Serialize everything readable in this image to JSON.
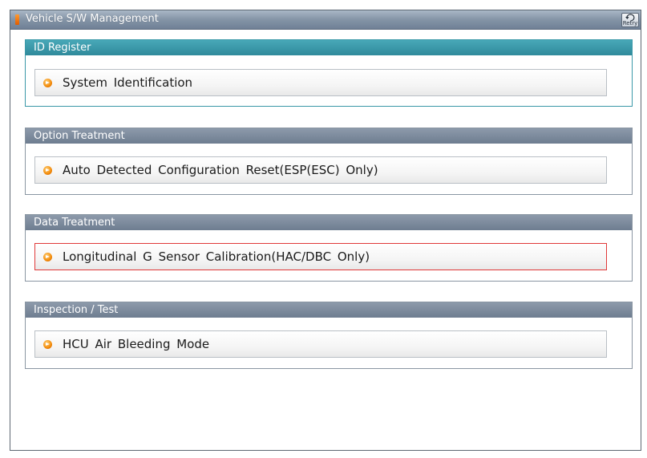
{
  "window": {
    "title": "Vehicle S/W Management",
    "retry_label": "Retry"
  },
  "sections": [
    {
      "title": "ID Register",
      "items": [
        "System Identification"
      ]
    },
    {
      "title": "Option Treatment",
      "items": [
        "Auto Detected Configuration Reset(ESP(ESC) Only)"
      ]
    },
    {
      "title": "Data Treatment",
      "items": [
        "Longitudinal G Sensor Calibration(HAC/DBC Only)"
      ]
    },
    {
      "title": "Inspection / Test",
      "items": [
        "HCU Air Bleeding Mode"
      ]
    }
  ],
  "state": {
    "active_section": "ID Register",
    "selected_item": "Longitudinal G Sensor Calibration(HAC/DBC Only)"
  },
  "colors": {
    "active_header": "#3a98a8",
    "inactive_header": "#7a889a",
    "selection_border": "#e03a3a",
    "bullet": "#f28a0a"
  },
  "icons": {
    "title": "orange-bar-icon",
    "retry": "retry-icon",
    "bullet": "arrow-bullet-icon"
  }
}
